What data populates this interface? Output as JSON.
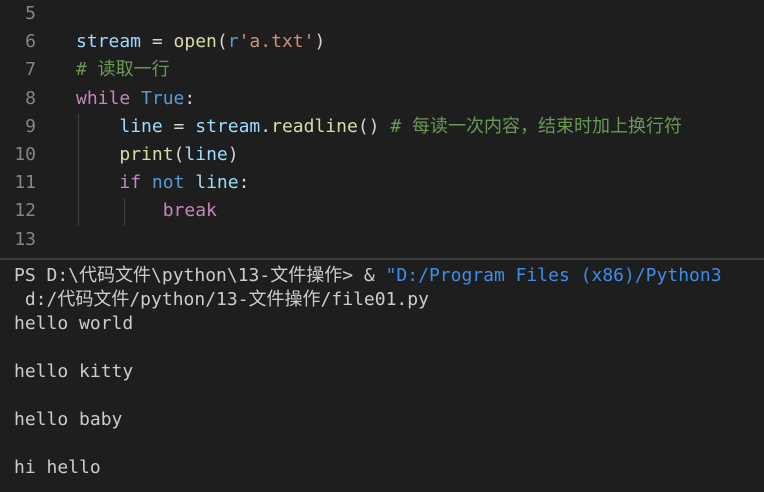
{
  "editor": {
    "lines": [
      {
        "number": "5",
        "tokens": []
      },
      {
        "number": "6",
        "tokens": [
          {
            "text": "stream",
            "kind": "var"
          },
          {
            "text": " = ",
            "kind": "op"
          },
          {
            "text": "open",
            "kind": "fn"
          },
          {
            "text": "(",
            "kind": "op"
          },
          {
            "text": "r",
            "kind": "pre"
          },
          {
            "text": "'a.txt'",
            "kind": "str"
          },
          {
            "text": ")",
            "kind": "op"
          }
        ]
      },
      {
        "number": "7",
        "tokens": [
          {
            "text": "# 读取一行",
            "kind": "cmt"
          }
        ]
      },
      {
        "number": "8",
        "tokens": [
          {
            "text": "while",
            "kind": "kw"
          },
          {
            "text": " ",
            "kind": "op"
          },
          {
            "text": "True",
            "kind": "pre"
          },
          {
            "text": ":",
            "kind": "op"
          }
        ]
      },
      {
        "number": "9",
        "tokens": [
          {
            "text": "    ",
            "kind": "op"
          },
          {
            "text": "line",
            "kind": "var"
          },
          {
            "text": " = ",
            "kind": "op"
          },
          {
            "text": "stream",
            "kind": "var"
          },
          {
            "text": ".",
            "kind": "op"
          },
          {
            "text": "readline",
            "kind": "fn"
          },
          {
            "text": "() ",
            "kind": "op"
          },
          {
            "text": "# 每读一次内容，结束时加上换行符",
            "kind": "cmt"
          }
        ]
      },
      {
        "number": "10",
        "tokens": [
          {
            "text": "    ",
            "kind": "op"
          },
          {
            "text": "print",
            "kind": "fn"
          },
          {
            "text": "(",
            "kind": "op"
          },
          {
            "text": "line",
            "kind": "var"
          },
          {
            "text": ")",
            "kind": "op"
          }
        ]
      },
      {
        "number": "11",
        "tokens": [
          {
            "text": "    ",
            "kind": "op"
          },
          {
            "text": "if",
            "kind": "kw"
          },
          {
            "text": " ",
            "kind": "op"
          },
          {
            "text": "not",
            "kind": "pre"
          },
          {
            "text": " ",
            "kind": "op"
          },
          {
            "text": "line",
            "kind": "var"
          },
          {
            "text": ":",
            "kind": "op"
          }
        ]
      },
      {
        "number": "12",
        "tokens": [
          {
            "text": "        ",
            "kind": "op"
          },
          {
            "text": "break",
            "kind": "kw"
          }
        ]
      },
      {
        "number": "13",
        "tokens": []
      }
    ]
  },
  "terminal": {
    "prompt": "PS D:\\代码文件\\python\\13-文件操作> ",
    "command": "& ",
    "command_path": "\"D:/Program Files (x86)/Python3",
    "command_arg": " d:/代码文件/python/13-文件操作/file01.py",
    "output": [
      "hello world",
      "",
      "hello kitty",
      "",
      "hello baby",
      "",
      "hi hello"
    ]
  }
}
